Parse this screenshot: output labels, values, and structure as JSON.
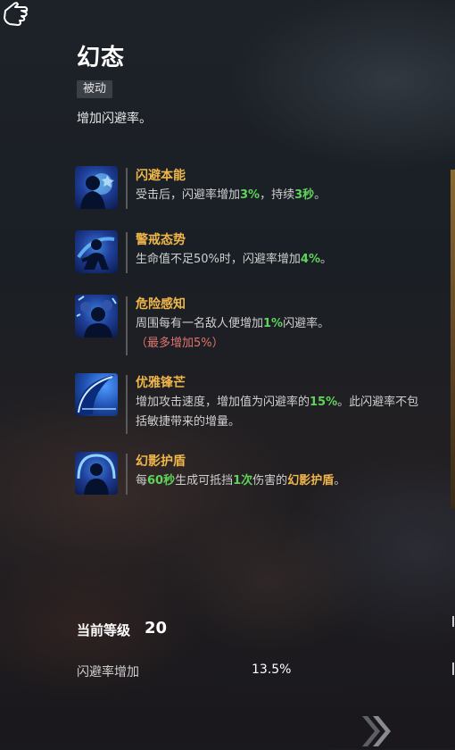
{
  "skill": {
    "title": "幻态",
    "type_tag": "被动",
    "description": "增加闪避率。"
  },
  "passives": [
    {
      "name": "闪避本能",
      "icon": "dodge-instinct-icon",
      "pre": "受击后，闪避率增加",
      "v1": "3%",
      "mid": "，持续",
      "v2": "3秒",
      "post": "。"
    },
    {
      "name": "警戒态势",
      "icon": "alert-stance-icon",
      "pre": "生命值不足50%时，闪避率增加",
      "v1": "4%",
      "post": "。"
    },
    {
      "name": "危险感知",
      "icon": "danger-sense-icon",
      "pre": "周围每有一名敌人便增加",
      "v1": "1%",
      "post": "闪避率。",
      "note": "（最多增加5%）"
    },
    {
      "name": "优雅锋芒",
      "icon": "elegant-edge-icon",
      "pre": "增加攻击速度，增加值为闪避率的",
      "v1": "15%",
      "post": "。此闪避率不包括敏捷带来的增量。"
    },
    {
      "name": "幻影护盾",
      "icon": "phantom-shield-icon",
      "pre": "每",
      "v1": "60秒",
      "mid": "生成可抵挡",
      "v2": "1次",
      "mid2": "伤害的",
      "v3": "幻影护盾",
      "post": "。"
    }
  ],
  "level": {
    "label": "当前等级",
    "value": "20"
  },
  "stat": {
    "label": "闪避率增加",
    "value": "13.5%"
  },
  "colors": {
    "highlight_green": "#5fd35a",
    "skill_name_orange": "#f0b64a",
    "note_red": "#e0736b"
  }
}
